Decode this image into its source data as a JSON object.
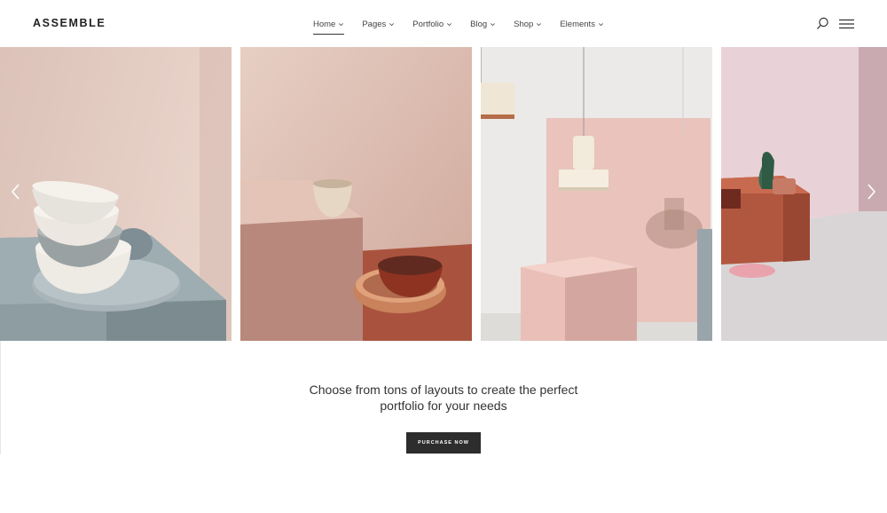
{
  "brand": {
    "logo": "ASSEMBLE"
  },
  "nav": {
    "items": [
      {
        "label": "Home",
        "active": true
      },
      {
        "label": "Pages",
        "active": false
      },
      {
        "label": "Portfolio",
        "active": false
      },
      {
        "label": "Blog",
        "active": false
      },
      {
        "label": "Shop",
        "active": false
      },
      {
        "label": "Elements",
        "active": false
      }
    ]
  },
  "header_icons": [
    "search-icon",
    "hamburger-menu-icon"
  ],
  "gallery": {
    "slides": [
      {
        "name": "stacked-bowls-photo"
      },
      {
        "name": "cup-and-tray-photo"
      },
      {
        "name": "pendant-lamps-photo"
      },
      {
        "name": "vase-on-block-photo"
      }
    ],
    "prev_icon": "chevron-left-icon",
    "next_icon": "chevron-right-icon"
  },
  "intro": {
    "line1": "Choose from tons of layouts to create the perfect",
    "line2": "portfolio for your needs"
  },
  "cta": {
    "label": "PURCHASE NOW"
  },
  "colors": {
    "accent_dark": "#2d2d2d",
    "blush": "#e3c5bc",
    "terracotta": "#b45f48",
    "sage_grey": "#8f9ea4"
  }
}
